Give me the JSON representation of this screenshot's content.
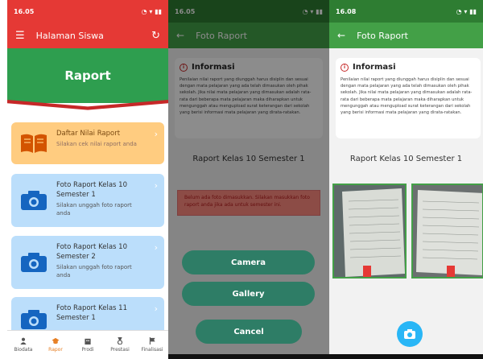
{
  "panel1": {
    "status_time": "16.05",
    "appbar_title": "Halaman Siswa",
    "hero_title": "Raport",
    "cards": [
      {
        "title": "Daftar Nilai Raport",
        "subtitle": "Silakan cek nilai raport anda",
        "color": "#ffcc80"
      },
      {
        "title": "Foto Raport Kelas 10 Semester 1",
        "subtitle": "Silakan unggah foto raport anda",
        "color": "#bbdefb"
      },
      {
        "title": "Foto Raport Kelas 10 Semester 2",
        "subtitle": "Silakan unggah foto raport anda",
        "color": "#bbdefb"
      },
      {
        "title": "Foto Raport Kelas 11 Semester 1",
        "subtitle": "",
        "color": "#bbdefb"
      }
    ],
    "nav": [
      "Biodata",
      "Rapor",
      "Prodi",
      "Prestasi",
      "Finalisasi"
    ],
    "nav_active": "Rapor"
  },
  "panel2": {
    "status_time": "16.05",
    "appbar_title": "Foto Raport",
    "info_title": "Informasi",
    "info_body": "Penilaian nilai raport yang diunggah harus disiplin dan sesuai dengan mata pelajaran yang ada telah dimasukan oleh pihak sekolah. Jika nilai mata pelajaran yang dimasukan adalah rata-rata dari beberapa mata pelajaran maka diharapkan untuk mengunggah atau mengupload surat keterangan dari sekolah yang berisi informasi mata pelajaran yang dirata-ratakan.",
    "raport_title": "Raport Kelas 10 Semester 1",
    "warning": "Belum ada foto dimasukkan. Silakan masukkan foto raport anda jika ada untuk semester ini.",
    "buttons": {
      "camera": "Camera",
      "gallery": "Gallery",
      "cancel": "Cancel"
    }
  },
  "panel3": {
    "status_time": "16.08",
    "appbar_title": "Foto Raport",
    "info_title": "Informasi",
    "info_body": "Penilaian nilai raport yang diunggah harus disiplin dan sesuai dengan mata pelajaran yang ada telah dimasukan oleh pihak sekolah. Jika nilai mata pelajaran yang dimasukan adalah rata-rata dari beberapa mata pelajaran maka diharapkan untuk mengunggah atau mengupload surat keterangan dari sekolah yang berisi informasi mata pelajaran yang dirata-ratakan.",
    "raport_title": "Raport Kelas 10 Semester 1"
  },
  "icons": {
    "menu": "menu-icon",
    "refresh": "refresh-icon",
    "back": "back-arrow-icon",
    "book": "book-icon",
    "camera": "camera-icon",
    "info": "info-icon",
    "delete": "delete-icon",
    "chevron": "chevron-right-icon"
  },
  "colors": {
    "red": "#e53935",
    "green": "#43a047",
    "button": "#2e7d66",
    "fab": "#29b6f6"
  }
}
